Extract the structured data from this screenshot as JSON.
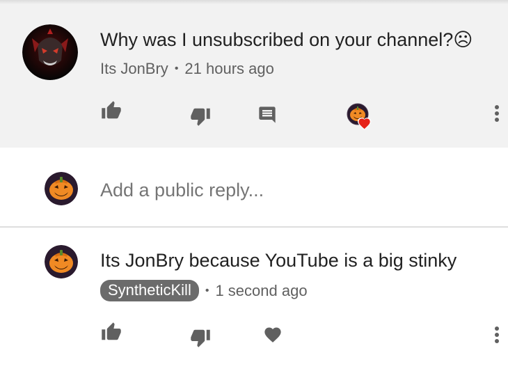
{
  "comment": {
    "text": "Why was I unsubscribed on your channel?☹",
    "author": "Its JonBry",
    "separator": "•",
    "time": "21 hours ago",
    "icons": [
      "thumbs-up-icon",
      "thumbs-down-icon",
      "reply-icon",
      "creator-heart-icon",
      "more-options-icon"
    ]
  },
  "reply_box": {
    "placeholder": "Add a public reply..."
  },
  "reply": {
    "text": "Its JonBry because YouTube is a big stinky",
    "author": "SyntheticKill",
    "separator": "•",
    "time": "1 second ago",
    "icons": [
      "thumbs-up-icon",
      "thumbs-down-icon",
      "heart-icon",
      "more-options-icon"
    ]
  },
  "colors": {
    "comment_background": "#f2f2f2",
    "icon_gray": "#606060",
    "heart_red": "#e62117",
    "author_badge": "#6b6b6b"
  }
}
